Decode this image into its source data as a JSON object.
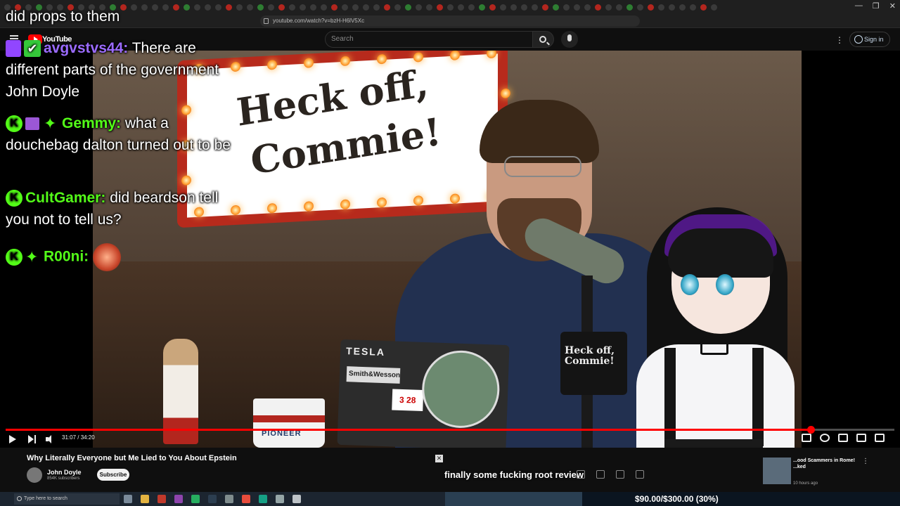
{
  "browser": {
    "url": "youtube.com/watch?v=bzH-H6lV5Xc"
  },
  "youtube": {
    "logo_text": "YouTube",
    "search_placeholder": "Search",
    "signin_label": "Sign in"
  },
  "video": {
    "sign_line1": "Heck off,",
    "sign_line2": "Commie!",
    "mic_box_label": "Heck off, Commie!",
    "laptop_brand": "TESLA",
    "laptop_sticker": "Smith&Wesson",
    "laptop_calendar": "3 28",
    "mug_label": "PIONEER"
  },
  "player": {
    "current_time": "31:07",
    "duration": "34:20",
    "time_display": "31:07 / 34:20",
    "progress": 0.906
  },
  "chat": {
    "top_line": "did props to them",
    "messages": [
      {
        "user": "avgvstvs44:",
        "text": "There are different parts of the government John Doyle",
        "user_color": "#9b6bff"
      },
      {
        "user": "Gemmy:",
        "text": "what a douchebag dalton turned out to be",
        "user_color": "#53fc18"
      },
      {
        "user": "CultGamer:",
        "text": "did beardson tell you not to tell us?",
        "user_color": "#53fc18"
      },
      {
        "user": "R00ni:",
        "text": "",
        "user_color": "#53fc18"
      }
    ]
  },
  "below": {
    "video_title": "Why Literally Everyone but Me Lied to You About Epstein",
    "channel_name": "John Doyle",
    "channel_subs": "854K subscribers",
    "subscribe_label": "Subscribe",
    "caption": "finally some fucking root review",
    "rec_title": "...ood Scammers in Rome!",
    "rec_title_2": "...ked",
    "rec_meta": "10 hours ago"
  },
  "taskbar": {
    "search_placeholder": "Type here to search",
    "goal_text": "$90.00/$300.00 (30%)",
    "goal_progress": 0.3
  },
  "colors": {
    "kick_green": "#53fc18",
    "yt_red": "#ff0000",
    "sign_red": "#b72a1c"
  }
}
